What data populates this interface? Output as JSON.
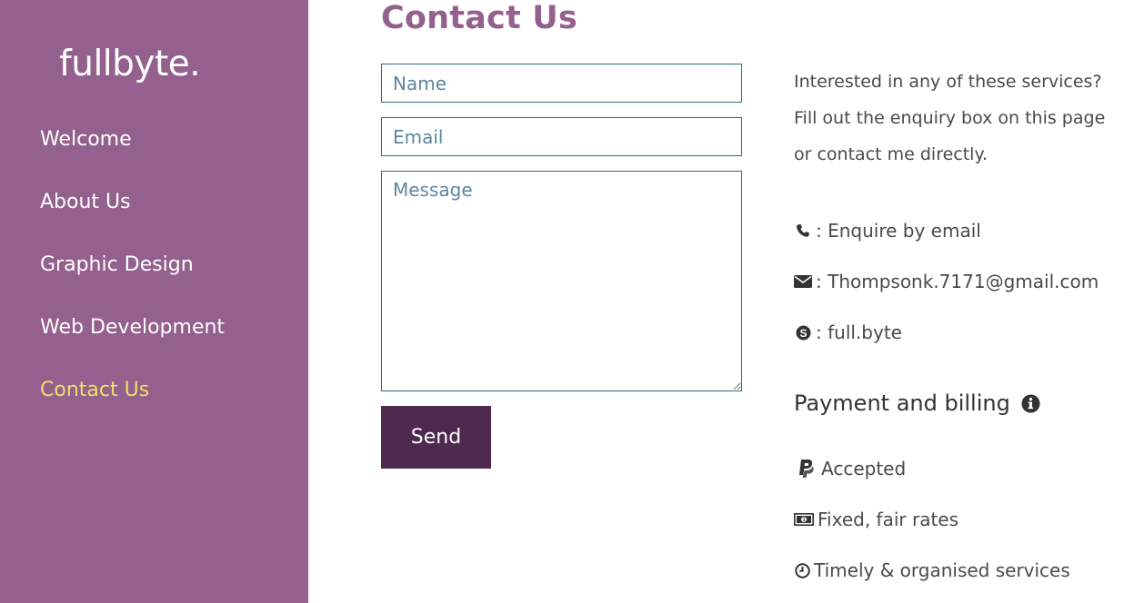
{
  "sidebar": {
    "brand": "fullbyte.",
    "items": [
      {
        "label": "Welcome",
        "active": false
      },
      {
        "label": "About Us",
        "active": false
      },
      {
        "label": "Graphic Design",
        "active": false
      },
      {
        "label": "Web Development",
        "active": false
      },
      {
        "label": "Contact Us",
        "active": true
      }
    ]
  },
  "main": {
    "title": "Contact Us",
    "form": {
      "name_placeholder": "Name",
      "email_placeholder": "Email",
      "message_placeholder": "Message",
      "send_label": "Send"
    }
  },
  "info": {
    "intro": "Interested in any of these services? Fill out the enquiry box on this page or contact me directly.",
    "contacts": [
      {
        "icon": "phone-icon",
        "text": ": Enquire by email"
      },
      {
        "icon": "envelope-icon",
        "text": ": Thompsonk.7171@gmail.com"
      },
      {
        "icon": "skype-icon",
        "text": ": full.byte"
      }
    ],
    "billing_title": "Payment and billing",
    "billing": [
      {
        "icon": "paypal-icon",
        "text": "Accepted"
      },
      {
        "icon": "money-icon",
        "text": "Fixed, fair rates"
      },
      {
        "icon": "clock-icon",
        "text": "Timely & organised services"
      }
    ]
  },
  "colors": {
    "sidebar_bg": "#94608d",
    "active_nav": "#f3dd6d",
    "title": "#94608d",
    "button_bg": "#4d2a4e",
    "field_border": "#2c6a83"
  }
}
